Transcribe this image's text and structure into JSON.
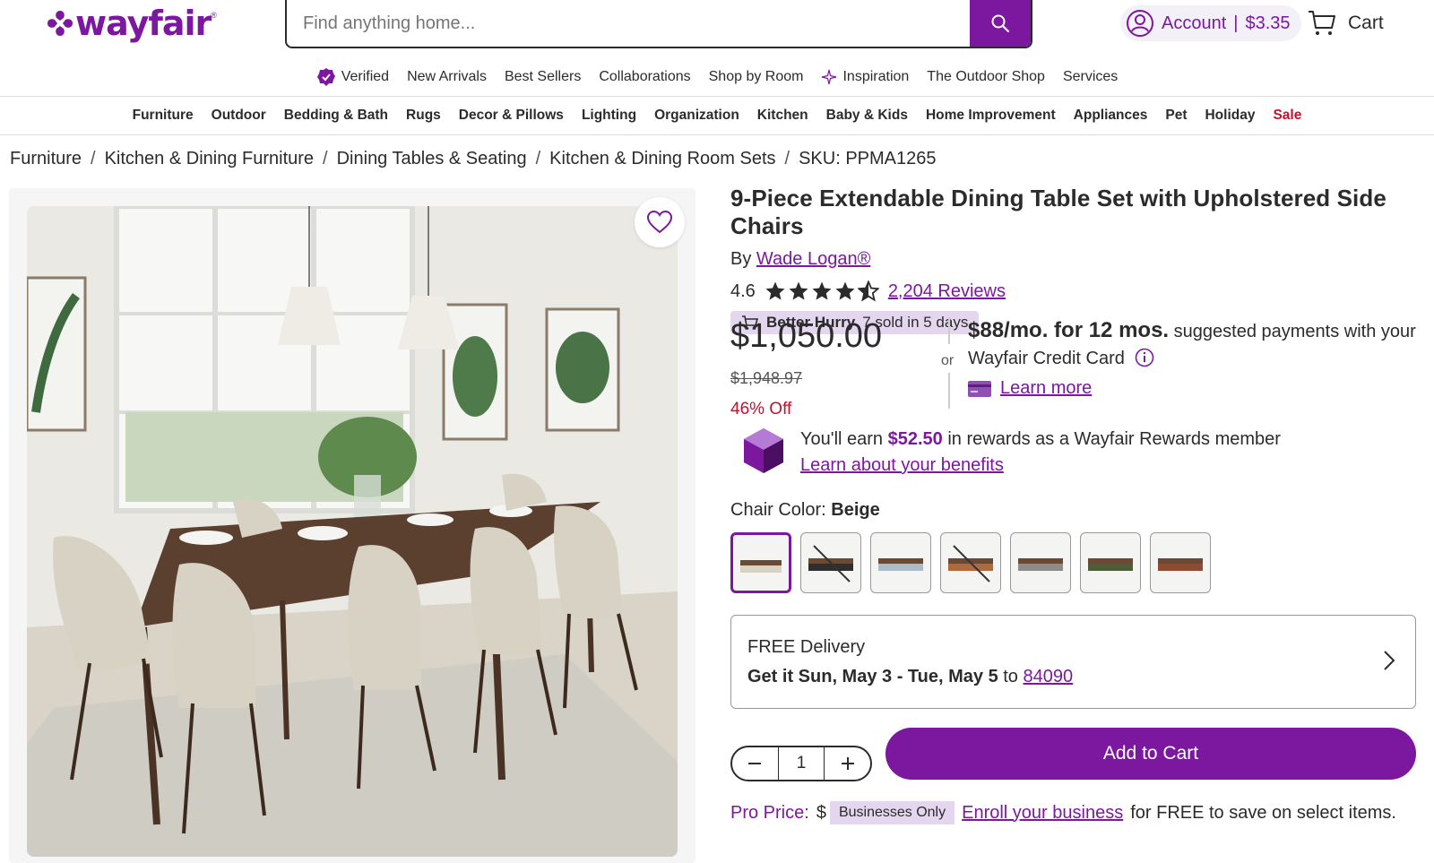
{
  "header": {
    "logo": "wayfair",
    "search_placeholder": "Find anything home...",
    "account_label": "Account",
    "account_balance": "$3.35",
    "cart_label": "Cart"
  },
  "topnav": [
    "Verified",
    "New Arrivals",
    "Best Sellers",
    "Collaborations",
    "Shop by Room",
    "Inspiration",
    "The Outdoor Shop",
    "Services"
  ],
  "catnav": [
    "Furniture",
    "Outdoor",
    "Bedding & Bath",
    "Rugs",
    "Decor & Pillows",
    "Lighting",
    "Organization",
    "Kitchen",
    "Baby & Kids",
    "Home Improvement",
    "Appliances",
    "Pet",
    "Holiday",
    "Sale"
  ],
  "breadcrumb": [
    "Furniture",
    "Kitchen & Dining Furniture",
    "Dining Tables & Seating",
    "Kitchen & Dining Room Sets",
    "SKU: PPMA1265"
  ],
  "product": {
    "title": "9-Piece Extendable Dining Table Set with Upholstered Side Chairs",
    "by": "By",
    "brand": "Wade Logan®",
    "rating": "4.6",
    "rating_value": 4.6,
    "reviews": "2,204 Reviews",
    "hurry_bold": "Better Hurry",
    "hurry_text": "7 sold in 5 days",
    "price": "$1,050.00",
    "old_price": "$1,948.97",
    "discount": "46% Off",
    "or": "or",
    "monthly": "$88/mo. for 12 mos.",
    "monthly_text": "suggested payments with your Wayfair Credit Card",
    "learn_more": "Learn more",
    "rewards_pre": "You'll earn",
    "rewards_amt": "$52.50",
    "rewards_post": "in rewards as a Wayfair Rewards member",
    "rewards_link": "Learn about your benefits",
    "color_label": "Chair Color:",
    "color_value": "Beige",
    "delivery_title": "FREE Delivery",
    "delivery_bold": "Get it Sun, May 3 - Tue, May 5",
    "delivery_to": "to",
    "zip": "84090",
    "qty": "1",
    "add_to_cart": "Add to Cart",
    "pro_label": "Pro Price:",
    "pro_price_partial": "$",
    "businesses_only": "Businesses Only",
    "enroll_link": "Enroll your business",
    "enroll_text": "for FREE to save on select items."
  },
  "colors": {
    "brand": "#7b189f",
    "sale": "#c3112e",
    "hurry_bg": "#e5d6ef"
  }
}
